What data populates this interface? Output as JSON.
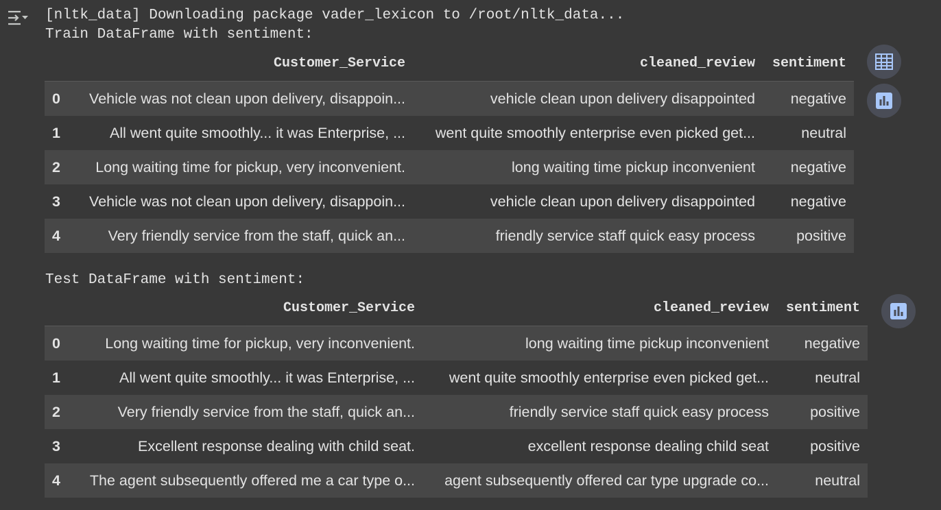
{
  "output": {
    "download_line": "[nltk_data] Downloading package vader_lexicon to /root/nltk_data...",
    "train_title": "Train DataFrame with sentiment:",
    "test_title": "Test DataFrame with sentiment:"
  },
  "icons": {
    "gutter": "output-toggle-icon",
    "table": "table-convert-icon",
    "chart": "bar-chart-icon"
  },
  "train_table": {
    "columns": [
      "",
      "Customer_Service",
      "cleaned_review",
      "sentiment"
    ],
    "rows": [
      [
        "0",
        "Vehicle was not clean upon delivery, disappoin...",
        "vehicle clean upon delivery disappointed",
        "negative"
      ],
      [
        "1",
        "All went quite smoothly... it was Enterprise, ...",
        "went quite smoothly enterprise even picked get...",
        "neutral"
      ],
      [
        "2",
        "Long waiting time for pickup, very inconvenient.",
        "long waiting time pickup inconvenient",
        "negative"
      ],
      [
        "3",
        "Vehicle was not clean upon delivery, disappoin...",
        "vehicle clean upon delivery disappointed",
        "negative"
      ],
      [
        "4",
        "Very friendly service from the staff, quick an...",
        "friendly service staff quick easy process",
        "positive"
      ]
    ]
  },
  "test_table": {
    "columns": [
      "",
      "Customer_Service",
      "cleaned_review",
      "sentiment"
    ],
    "rows": [
      [
        "0",
        "Long waiting time for pickup, very inconvenient.",
        "long waiting time pickup inconvenient",
        "negative"
      ],
      [
        "1",
        "All went quite smoothly... it was Enterprise, ...",
        "went quite smoothly enterprise even picked get...",
        "neutral"
      ],
      [
        "2",
        "Very friendly service from the staff, quick an...",
        "friendly service staff quick easy process",
        "positive"
      ],
      [
        "3",
        "Excellent response dealing with child seat.",
        "excellent response dealing child seat",
        "positive"
      ],
      [
        "4",
        "The agent subsequently offered me a car type o...",
        "agent subsequently offered car type upgrade co...",
        "neutral"
      ]
    ]
  },
  "colors": {
    "background": "#383838",
    "row_stripe": "#474747",
    "text": "#e3e3e3",
    "fab_background": "#4a4d57",
    "fab_icon": "#a8c7fa"
  }
}
